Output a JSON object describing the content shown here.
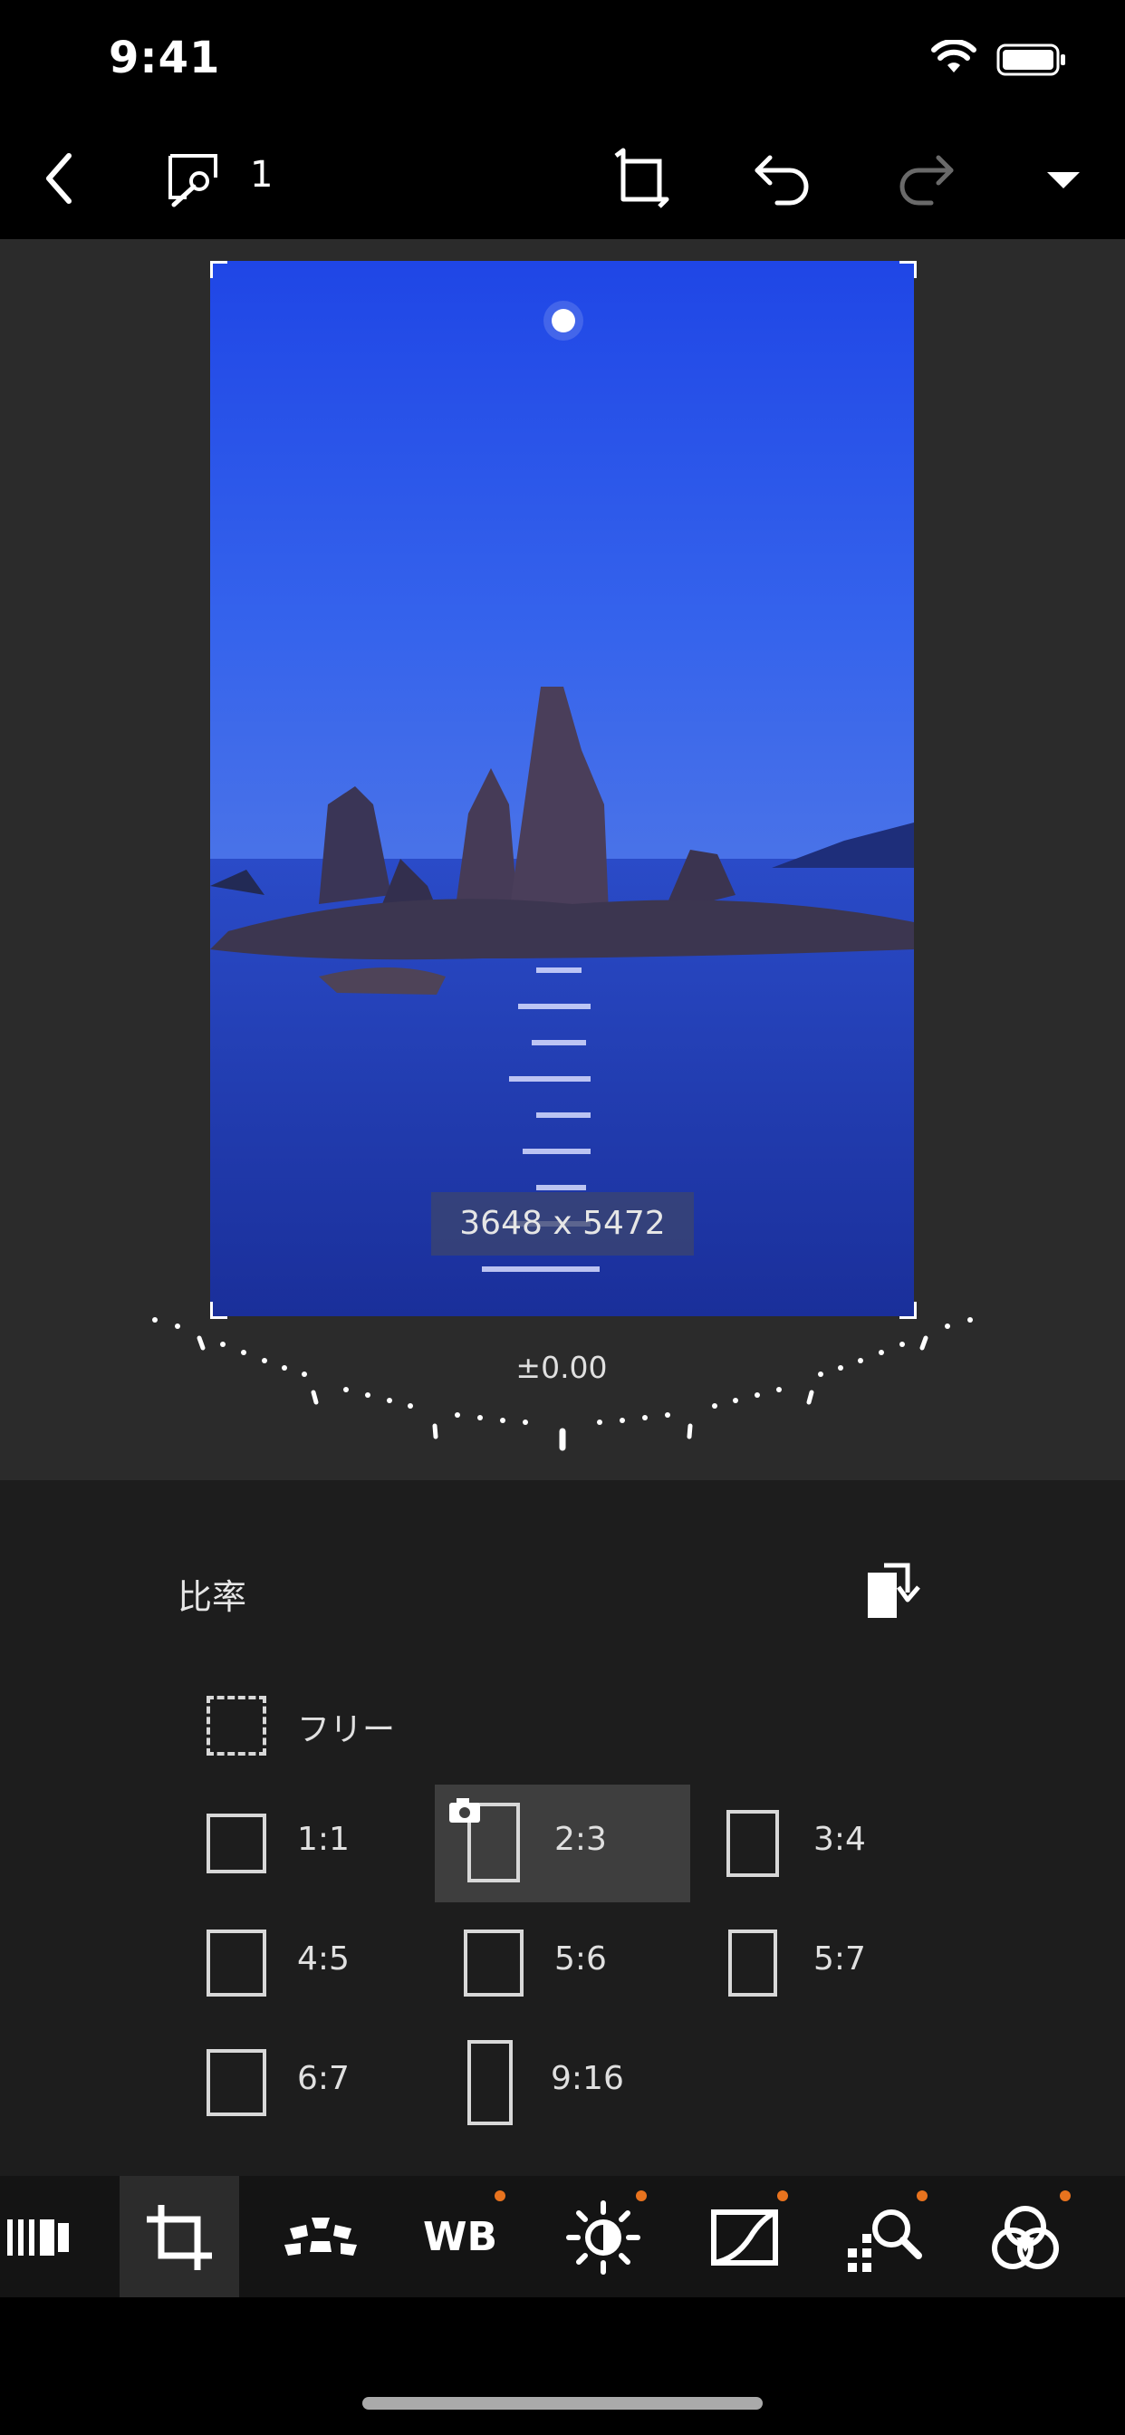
{
  "status_bar": {
    "time": "9:41"
  },
  "toolbar": {
    "image_count": "1"
  },
  "photo": {
    "dimensions": "3648 x 5472"
  },
  "rotation": {
    "value": "±0.00"
  },
  "ratio_panel": {
    "title": "比率",
    "free_label": "フリー",
    "options": [
      {
        "label": "1:1"
      },
      {
        "label": "2:3",
        "selected": true
      },
      {
        "label": "3:4"
      },
      {
        "label": "4:5"
      },
      {
        "label": "5:6"
      },
      {
        "label": "5:7"
      },
      {
        "label": "6:7"
      },
      {
        "label": "9:16"
      }
    ]
  },
  "tabs": [
    {
      "icon": "presets-icon"
    },
    {
      "icon": "crop-icon",
      "active": true
    },
    {
      "icon": "lens-correction-icon"
    },
    {
      "icon": "wb-icon",
      "text": "WB",
      "modified": true
    },
    {
      "icon": "brightness-icon",
      "modified": true
    },
    {
      "icon": "tone-curve-icon",
      "modified": true
    },
    {
      "icon": "detail-icon",
      "modified": true
    },
    {
      "icon": "color-icon",
      "modified": true
    }
  ],
  "colors": {
    "accent": "#e8731e",
    "selected_bg": "#3e3e3e"
  }
}
